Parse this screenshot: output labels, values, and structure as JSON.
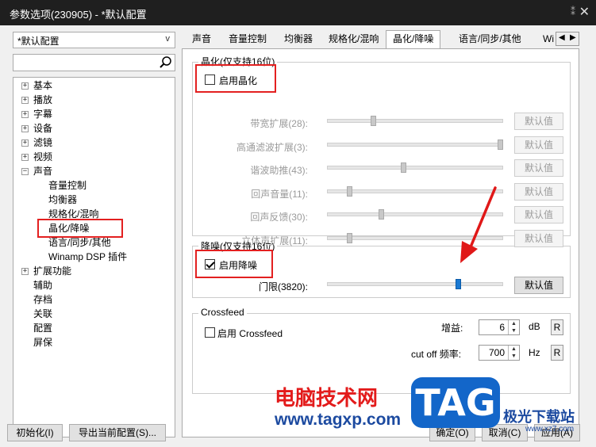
{
  "window": {
    "title": "参数选项(230905) - *默认配置",
    "pin": "⁑",
    "close": "✕"
  },
  "profile_combo": {
    "value": "*默认配置",
    "arrow": "v"
  },
  "tree": [
    {
      "label": "基本",
      "exp": "+"
    },
    {
      "label": "播放",
      "exp": "+"
    },
    {
      "label": "字幕",
      "exp": "+"
    },
    {
      "label": "设备",
      "exp": "+"
    },
    {
      "label": "滤镜",
      "exp": "+"
    },
    {
      "label": "视频",
      "exp": "+"
    },
    {
      "label": "声音",
      "exp": "−"
    },
    {
      "label": "音量控制"
    },
    {
      "label": "均衡器"
    },
    {
      "label": "规格化/混响"
    },
    {
      "label": "晶化/降噪"
    },
    {
      "label": "语言/同步/其他"
    },
    {
      "label": "Winamp DSP 插件"
    },
    {
      "label": "扩展功能",
      "exp": "+"
    },
    {
      "label": "辅助"
    },
    {
      "label": "存档"
    },
    {
      "label": "关联"
    },
    {
      "label": "配置"
    },
    {
      "label": "屏保"
    }
  ],
  "tabs": [
    "声音",
    "音量控制",
    "均衡器",
    "规格化/混响",
    "晶化/降噪",
    "语言/同步/其他",
    "Wi"
  ],
  "crystalize": {
    "group_title": "晶化(仅支持16位)",
    "enable_label": "启用晶化",
    "enabled": false,
    "rows": [
      {
        "label": "带宽扩展(28):",
        "level": 0.25,
        "button": "默认值"
      },
      {
        "label": "高通滤波扩展(3):",
        "level": 1.0,
        "button": "默认值"
      },
      {
        "label": "谐波助推(43):",
        "level": 0.43,
        "button": "默认值"
      },
      {
        "label": "回声音量(11):",
        "level": 0.11,
        "button": "默认值"
      },
      {
        "label": "回声反馈(30):",
        "level": 0.3,
        "button": "默认值"
      },
      {
        "label": "立体声扩展(11):",
        "level": 0.11,
        "button": "默认值"
      }
    ]
  },
  "denoise": {
    "group_title": "降噪(仅支持16位)",
    "enable_label": "启用降噪",
    "enabled": true,
    "threshold_label": "门限(3820):",
    "threshold_level": 0.75,
    "button": "默认值"
  },
  "crossfeed": {
    "group_title": "Crossfeed",
    "enable_label": "启用 Crossfeed",
    "enabled": false,
    "gain_label": "增益:",
    "gain_value": "6",
    "gain_unit": "dB",
    "cutoff_label": "cut off 频率:",
    "cutoff_value": "700",
    "cutoff_unit": "Hz",
    "reset_label": "R"
  },
  "footer": {
    "init_button": "初始化(I)",
    "export_button": "导出当前配置(S)...",
    "ok_button": "确定(O)",
    "cancel_button": "取消(C)",
    "apply_button": "应用(A)"
  },
  "watermark": {
    "cn": "电脑技术网",
    "url": "www.tagxp.com",
    "tag": "TAG",
    "xz": "极光下载站",
    "site": "www.xz7.com"
  },
  "colors": {
    "titlebar": "#1f1f1f",
    "highlight_red": "#e32020",
    "slider_active": "#1a79d2",
    "arrow": "#e01818"
  }
}
